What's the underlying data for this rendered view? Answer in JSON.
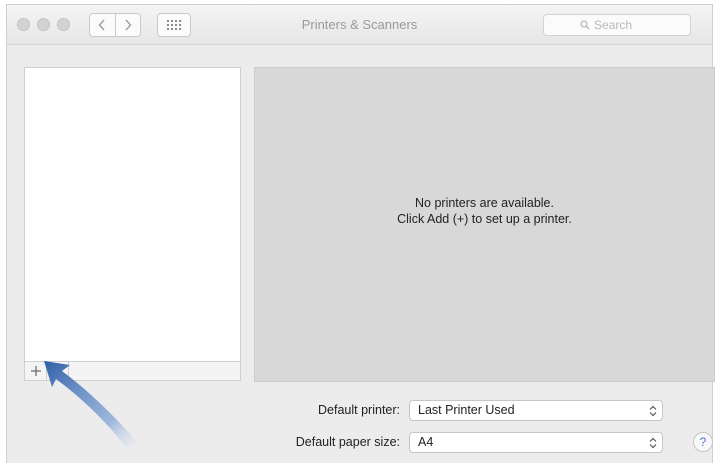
{
  "window": {
    "title": "Printers & Scanners"
  },
  "toolbar": {
    "back_icon": "chevron-left-icon",
    "forward_icon": "chevron-right-icon",
    "show_all_icon": "grid-icon"
  },
  "search": {
    "placeholder": "Search",
    "icon": "search-icon"
  },
  "printer_list": {
    "items": [],
    "add_label": "+"
  },
  "detail": {
    "line1": "No printers are available.",
    "line2": "Click Add (+) to set up a printer."
  },
  "settings": {
    "default_printer_label": "Default printer:",
    "default_printer_value": "Last Printer Used",
    "default_paper_label": "Default paper size:",
    "default_paper_value": "A4"
  },
  "help": {
    "label": "?"
  },
  "colors": {
    "annotation_arrow": "#2f5fa8",
    "detail_background": "#d8d8d8"
  }
}
